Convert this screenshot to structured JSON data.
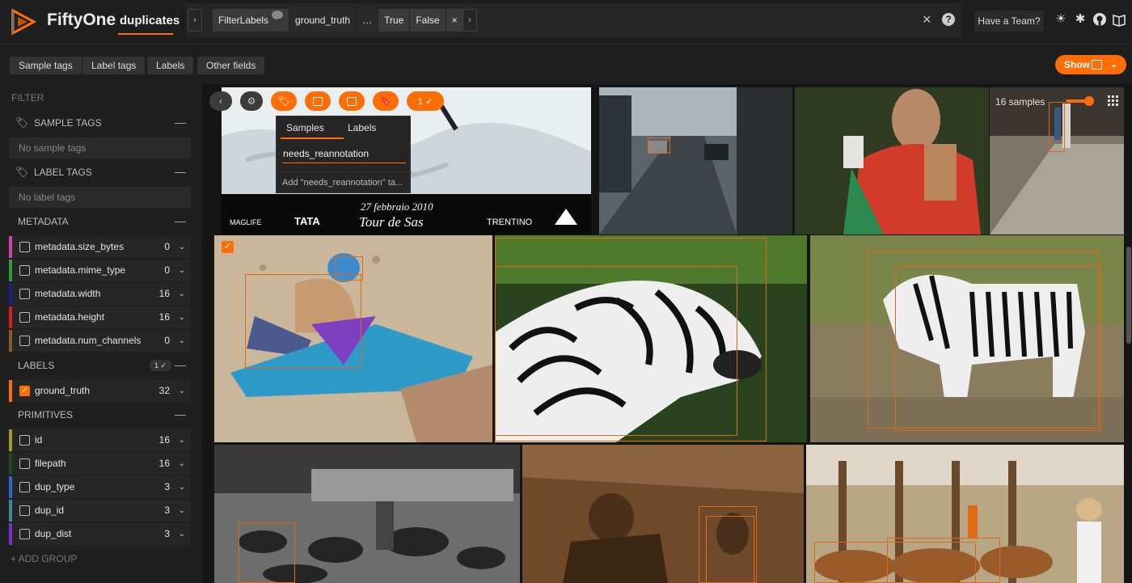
{
  "app": {
    "title": "FiftyOne",
    "dataset": "duplicates"
  },
  "view_bar": {
    "stage_name": "FilterLabels",
    "stage_help": "?",
    "field": "ground_truth",
    "more": "…",
    "option_true": "True",
    "option_false": "False",
    "remove": "×",
    "prev_arrow": "›",
    "next_arrow": "›"
  },
  "header": {
    "close": "×",
    "help": "?",
    "team_button": "Have a Team?"
  },
  "tabs": [
    "Sample tags",
    "Label tags",
    "Labels",
    "Other fields"
  ],
  "show_button": {
    "label": "Show",
    "chevron": "⌄"
  },
  "sidebar": {
    "filter_label": "FILTER",
    "sample_tags": {
      "title": "SAMPLE TAGS",
      "empty": "No sample tags"
    },
    "label_tags": {
      "title": "LABEL TAGS",
      "empty": "No label tags"
    },
    "metadata": {
      "title": "METADATA",
      "fields": [
        {
          "name": "metadata.size_bytes",
          "count": "0",
          "color": "#d43fb1"
        },
        {
          "name": "metadata.mime_type",
          "count": "0",
          "color": "#2e9e3a"
        },
        {
          "name": "metadata.width",
          "count": "16",
          "color": "#1c1c8f"
        },
        {
          "name": "metadata.height",
          "count": "16",
          "color": "#d41f1f"
        },
        {
          "name": "metadata.num_channels",
          "count": "0",
          "color": "#8a5a2a"
        }
      ]
    },
    "labels": {
      "title": "LABELS",
      "badge": "1 ✓",
      "fields": [
        {
          "name": "ground_truth",
          "count": "32",
          "color": "#ff6d04",
          "checked": "✓"
        }
      ]
    },
    "primitives": {
      "title": "PRIMITIVES",
      "fields": [
        {
          "name": "id",
          "count": "16",
          "color": "#9e9e1c"
        },
        {
          "name": "filepath",
          "count": "16",
          "color": "#1c4a1c"
        },
        {
          "name": "dup_type",
          "count": "3",
          "color": "#2d66d4"
        },
        {
          "name": "dup_id",
          "count": "3",
          "color": "#2f8f9a"
        },
        {
          "name": "dup_dist",
          "count": "3",
          "color": "#7a2fd4"
        }
      ]
    },
    "add_group": "+ ADD GROUP"
  },
  "grid_toolbar": {
    "samples_count": "16 samples",
    "selected_badge": "1 ✓"
  },
  "tag_popup": {
    "tab_samples": "Samples",
    "tab_labels": "Labels",
    "input_value": "needs_reannotation",
    "hint": "Add \"needs_reannotation\" ta..."
  },
  "banner_text": {
    "date": "27 febbraio 2010",
    "event": "Tour de Sas",
    "sponsor1": "TATA",
    "sponsor2": "TRENTINO",
    "sponsor3": "MAGLIFE"
  },
  "colors": {
    "accent": "#ff6d04",
    "background": "#1b1b1b"
  }
}
